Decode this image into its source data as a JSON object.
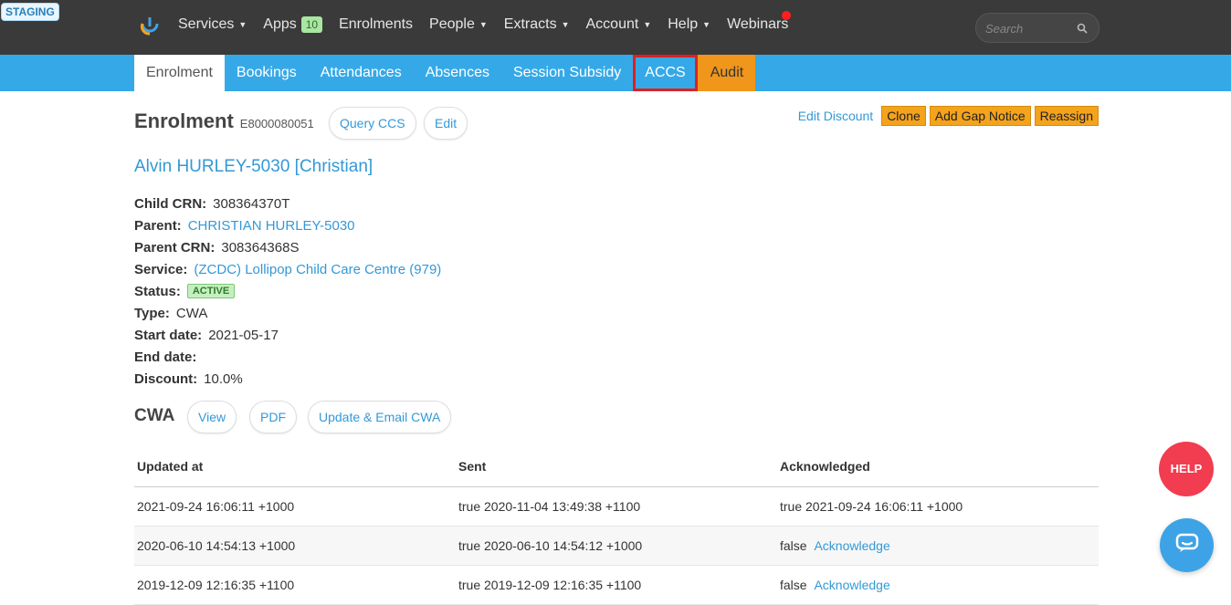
{
  "env_badge": "STAGING",
  "nav": {
    "items": [
      {
        "label": "Services",
        "caret": true
      },
      {
        "label": "Apps",
        "badge": "10"
      },
      {
        "label": "Enrolments"
      },
      {
        "label": "People",
        "caret": true
      },
      {
        "label": "Extracts",
        "caret": true
      },
      {
        "label": "Account",
        "caret": true
      },
      {
        "label": "Help",
        "caret": true
      },
      {
        "label": "Webinars"
      }
    ],
    "search_placeholder": "Search"
  },
  "subnav": {
    "tabs": [
      "Enrolment",
      "Bookings",
      "Attendances",
      "Absences",
      "Session Subsidy",
      "ACCS",
      "Audit"
    ],
    "active": "Enrolment",
    "highlighted": "ACCS"
  },
  "enrolment": {
    "title": "Enrolment",
    "id": "E8000080051",
    "query_ccs_label": "Query CCS",
    "edit_label": "Edit",
    "actions": {
      "edit_discount": "Edit Discount",
      "clone": "Clone",
      "add_gap_notice": "Add Gap Notice",
      "reassign": "Reassign"
    },
    "child_name": "Alvin HURLEY-5030 [Christian]",
    "fields": {
      "child_crn_label": "Child CRN:",
      "child_crn": "308364370T",
      "parent_label": "Parent:",
      "parent": "CHRISTIAN HURLEY-5030",
      "parent_crn_label": "Parent CRN:",
      "parent_crn": "308364368S",
      "service_label": "Service:",
      "service": "(ZCDC) Lollipop Child Care Centre (979)",
      "status_label": "Status:",
      "status": "ACTIVE",
      "type_label": "Type:",
      "type": "CWA",
      "start_date_label": "Start date:",
      "start_date": "2021-05-17",
      "end_date_label": "End date:",
      "end_date": "",
      "discount_label": "Discount:",
      "discount": "10.0%"
    }
  },
  "cwa": {
    "title": "CWA",
    "view_label": "View",
    "pdf_label": "PDF",
    "update_label": "Update & Email CWA",
    "columns": [
      "Updated at",
      "Sent",
      "Acknowledged"
    ],
    "rows": [
      {
        "updated": "2021-09-24 16:06:11 +1000",
        "sent": "true 2020-11-04 13:49:38 +1100",
        "ack": "true 2021-09-24 16:06:11 +1000",
        "ack_link": ""
      },
      {
        "updated": "2020-06-10 14:54:13 +1000",
        "sent": "true 2020-06-10 14:54:12 +1000",
        "ack": "false",
        "ack_link": "Acknowledge"
      },
      {
        "updated": "2019-12-09 12:16:35 +1100",
        "sent": "true 2019-12-09 12:16:35 +1100",
        "ack": "false",
        "ack_link": "Acknowledge"
      }
    ]
  },
  "help_label": "HELP",
  "colors": {
    "topbar": "#3a3a3a",
    "subbar": "#35a9e8",
    "audit": "#f0961a",
    "link": "#3399d6",
    "help": "#f23c4f"
  }
}
